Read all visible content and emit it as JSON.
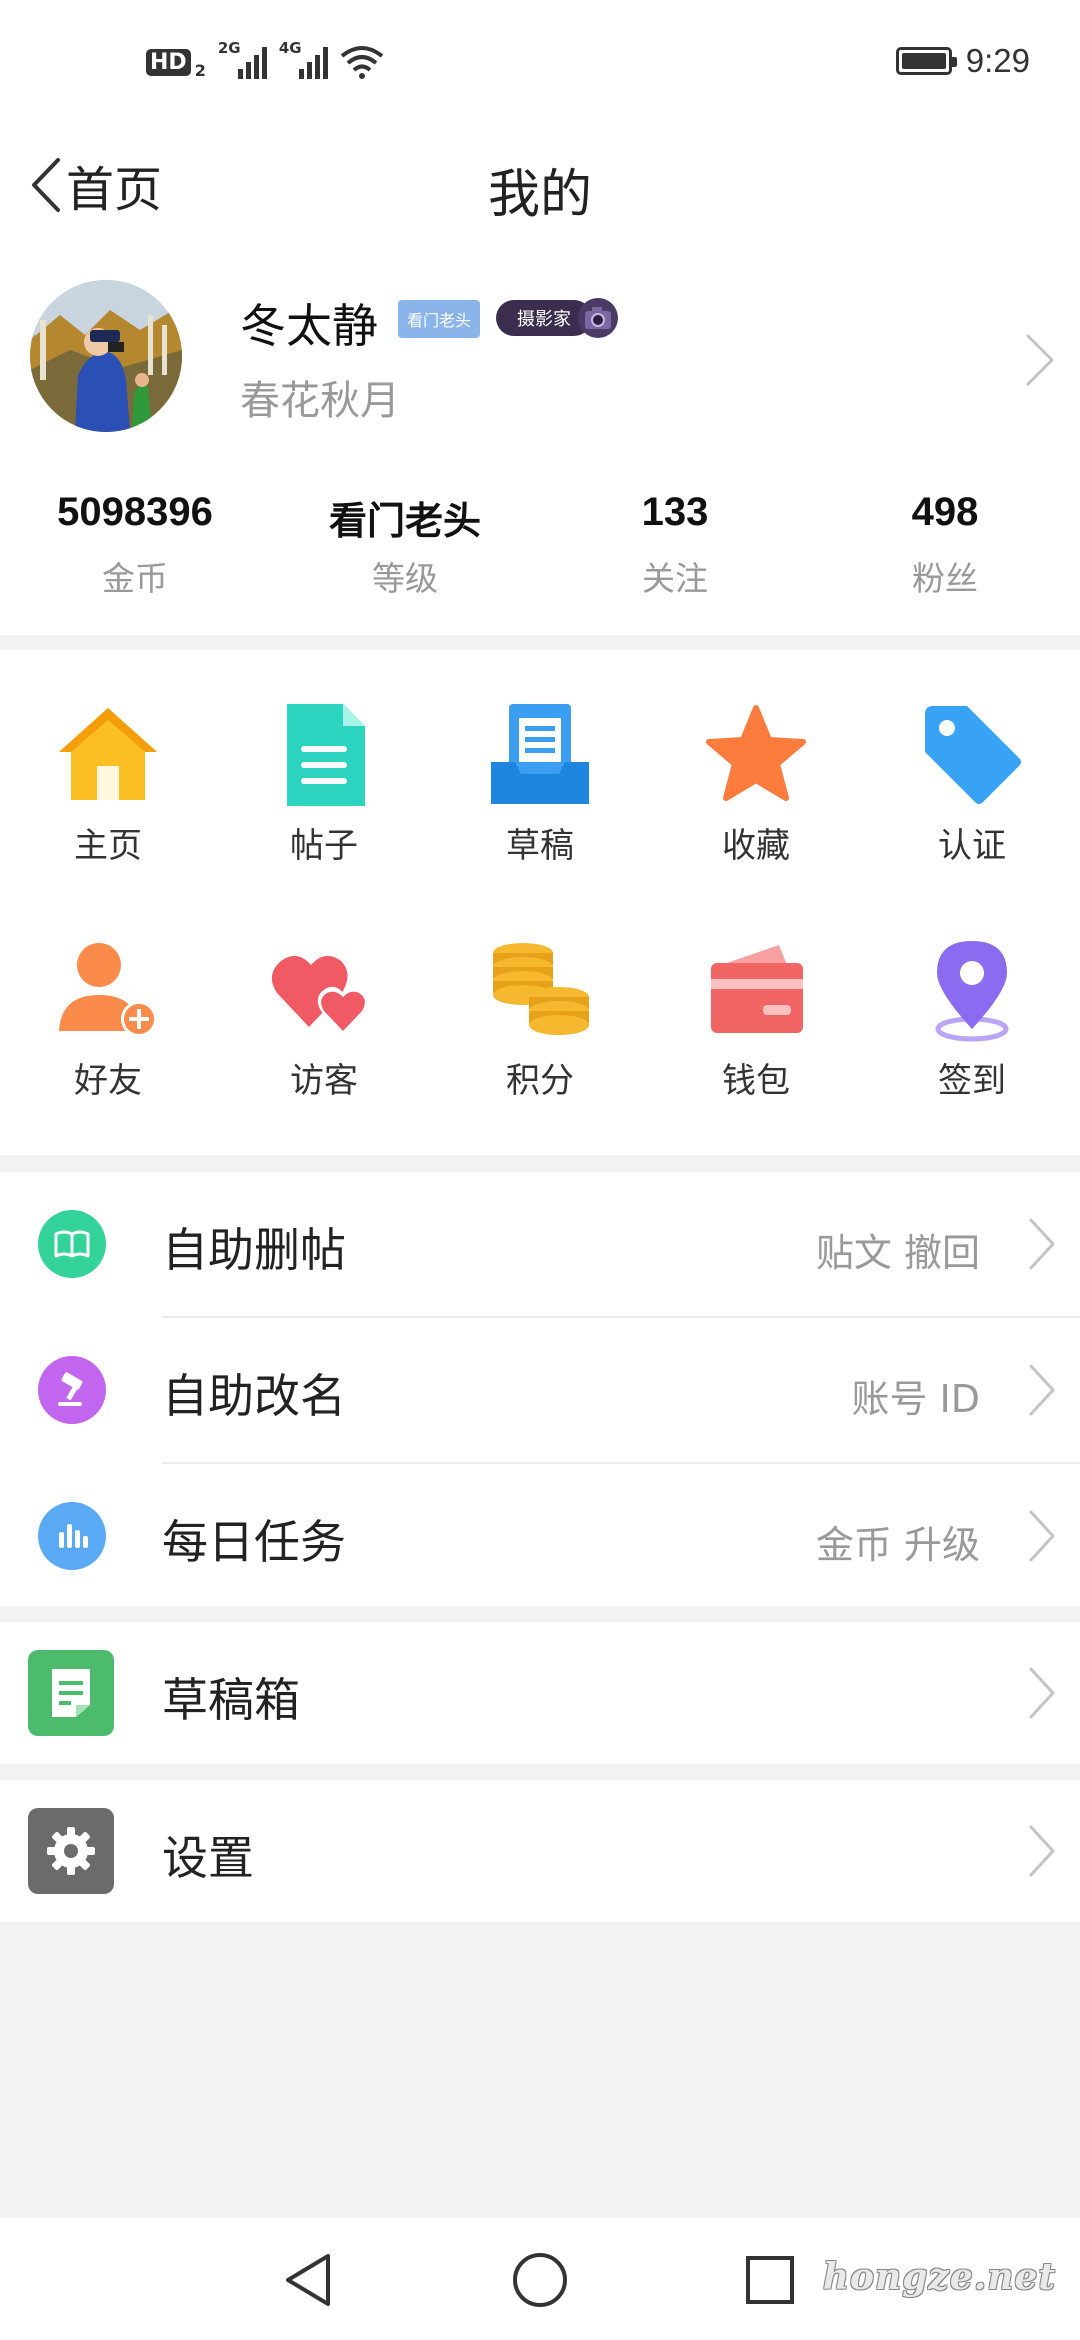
{
  "status_bar": {
    "hd_label": "HD",
    "hd_sub": "2",
    "net1": "2G",
    "net2": "4G",
    "time": "9:29",
    "icons": [
      "signal-icon",
      "wifi-icon",
      "battery-icon"
    ]
  },
  "header": {
    "back_label": "首页",
    "title": "我的"
  },
  "profile": {
    "username": "冬太静",
    "rank_badge": "看门老头",
    "photo_badge": "摄影家",
    "signature": "春花秋月"
  },
  "stats": [
    {
      "value": "5098396",
      "label": "金币"
    },
    {
      "value": "看门老头",
      "label": "等级"
    },
    {
      "value": "133",
      "label": "关注"
    },
    {
      "value": "498",
      "label": "粉丝"
    }
  ],
  "grid": [
    {
      "label": "主页",
      "icon": "home-icon",
      "color": "#fbbf24"
    },
    {
      "label": "帖子",
      "icon": "document-icon",
      "color": "#2dd4bf"
    },
    {
      "label": "草稿",
      "icon": "draft-tray-icon",
      "color": "#3b9ef0"
    },
    {
      "label": "收藏",
      "icon": "star-icon",
      "color": "#fb7c3c"
    },
    {
      "label": "认证",
      "icon": "tag-icon",
      "color": "#38a3f5"
    },
    {
      "label": "好友",
      "icon": "add-friend-icon",
      "color": "#fb8b4a"
    },
    {
      "label": "访客",
      "icon": "hearts-icon",
      "color": "#f05a64"
    },
    {
      "label": "积分",
      "icon": "coins-icon",
      "color": "#f5b82e"
    },
    {
      "label": "钱包",
      "icon": "wallet-icon",
      "color": "#f06464"
    },
    {
      "label": "签到",
      "icon": "location-pin-icon",
      "color": "#8b6cf0"
    }
  ],
  "list": [
    {
      "title": "自助删帖",
      "hint": "贴文  撤回",
      "icon": "book-icon",
      "color": "#34d399"
    },
    {
      "title": "自助改名",
      "hint": "账号  ID",
      "icon": "gavel-icon",
      "color": "#c266f0"
    },
    {
      "title": "每日任务",
      "hint": "金币  升级",
      "icon": "bar-chart-icon",
      "color": "#5aa9f5"
    }
  ],
  "cards": [
    {
      "title": "草稿箱",
      "icon": "note-icon",
      "color": "#4cbb6c"
    },
    {
      "title": "设置",
      "icon": "gear-icon",
      "color": "#6b6b6b"
    }
  ],
  "watermark": "hongze.net"
}
